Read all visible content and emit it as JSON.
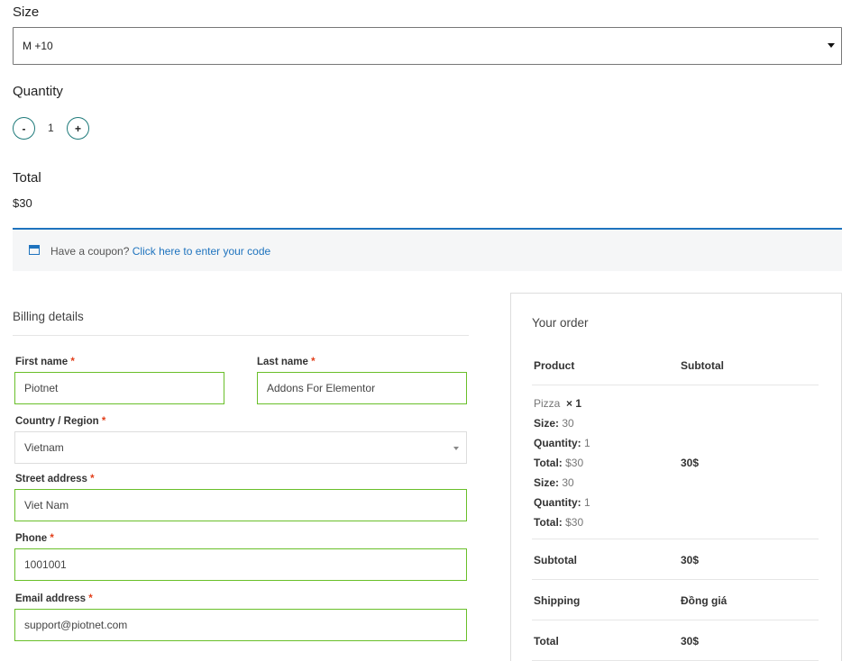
{
  "product_options": {
    "size_label": "Size",
    "size_value": "M +10",
    "quantity_label": "Quantity",
    "quantity_minus": "-",
    "quantity_value": "1",
    "quantity_plus": "+",
    "total_label": "Total",
    "total_value": "$30"
  },
  "coupon": {
    "icon": "window-icon",
    "text": "Have a coupon?",
    "link": "Click here to enter your code",
    "accent_color": "#1e73be"
  },
  "billing": {
    "title": "Billing details",
    "required_mark": "*",
    "first_name_label": "First name",
    "first_name_value": "Piotnet",
    "last_name_label": "Last name",
    "last_name_value": "Addons For Elementor",
    "country_label": "Country / Region",
    "country_value": "Vietnam",
    "street_label": "Street address",
    "street_value": "Viet Nam",
    "phone_label": "Phone",
    "phone_value": "1001001",
    "email_label": "Email address",
    "email_value": "support@piotnet.com",
    "valid_border_color": "#69bf29"
  },
  "order": {
    "title": "Your order",
    "col_product": "Product",
    "col_subtotal": "Subtotal",
    "item_name": "Pizza",
    "item_qty": "× 1",
    "meta": [
      {
        "key": "Size:",
        "value": " 30"
      },
      {
        "key": "Quantity:",
        "value": " 1"
      },
      {
        "key": "Total:",
        "value": " $30"
      },
      {
        "key": "Size:",
        "value": " 30"
      },
      {
        "key": "Quantity:",
        "value": " 1"
      },
      {
        "key": "Total:",
        "value": " $30"
      }
    ],
    "item_subtotal": "30$",
    "subtotal_label": "Subtotal",
    "subtotal_value": "30$",
    "shipping_label": "Shipping",
    "shipping_value": "Đồng giá",
    "total_label": "Total",
    "total_value": "30$"
  }
}
